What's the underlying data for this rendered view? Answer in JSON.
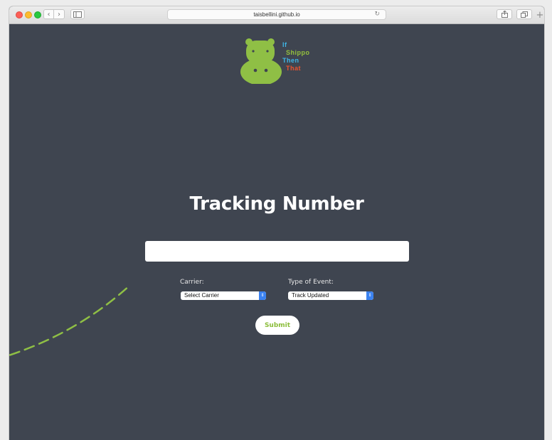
{
  "browser": {
    "url": "taisbellini.github.io",
    "back_icon": "‹",
    "forward_icon": "›",
    "reload_icon": "↻",
    "new_tab_icon": "+"
  },
  "logo": {
    "line1": "If",
    "line2": "Shippo",
    "line3": "Then",
    "line4": "That",
    "colors": {
      "hippo": "#8fbf45",
      "blue": "#3fb7e8",
      "green": "#95c13d",
      "orange": "#f0542d"
    }
  },
  "form": {
    "heading": "Tracking Number",
    "tracking_value": "",
    "carrier_label": "Carrier:",
    "carrier_selected": "Select Carrier",
    "event_label": "Type of Event:",
    "event_selected": "Track Updated",
    "submit_label": "Submit"
  },
  "theme": {
    "background": "#3f4550",
    "accent": "#8bbd3a"
  }
}
